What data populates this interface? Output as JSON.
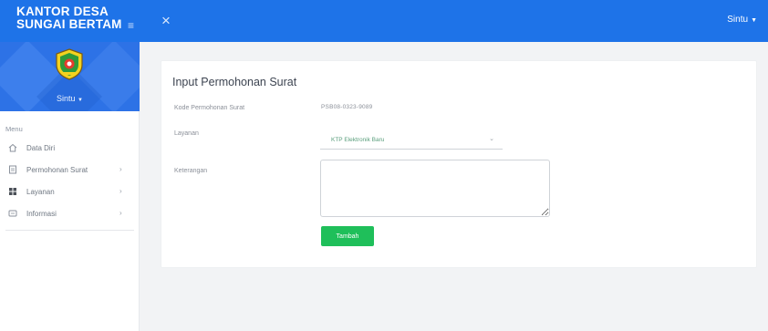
{
  "app": {
    "title_line1": "KANTOR DESA",
    "title_line2": "SUNGAI BERTAM",
    "menu_toggle_icon": "hamburger-icon",
    "close_icon": "close-icon",
    "user_label": "Sintu"
  },
  "sidebar": {
    "profile_name": "Sintu",
    "menu_heading": "Menu",
    "items": [
      {
        "label": "Data Diri",
        "icon": "home-icon",
        "has_submenu": false
      },
      {
        "label": "Permohonan Surat",
        "icon": "document-icon",
        "has_submenu": true
      },
      {
        "label": "Layanan",
        "icon": "grid-icon",
        "has_submenu": true
      },
      {
        "label": "Informasi",
        "icon": "info-icon",
        "has_submenu": true
      }
    ]
  },
  "form": {
    "title": "Input Permohonan Surat",
    "kode_label": "Kode Permohonan Surat",
    "kode_value": "PSB08-0323-9089",
    "layanan_label": "Layanan",
    "layanan_value": "KTP Elektronik Baru",
    "keterangan_label": "Keterangan",
    "keterangan_value": "",
    "submit_label": "Tambah"
  },
  "colors": {
    "primary": "#1e73e8",
    "success": "#1fbf5a",
    "sidebar_profile_bg": "#2d72e6"
  }
}
